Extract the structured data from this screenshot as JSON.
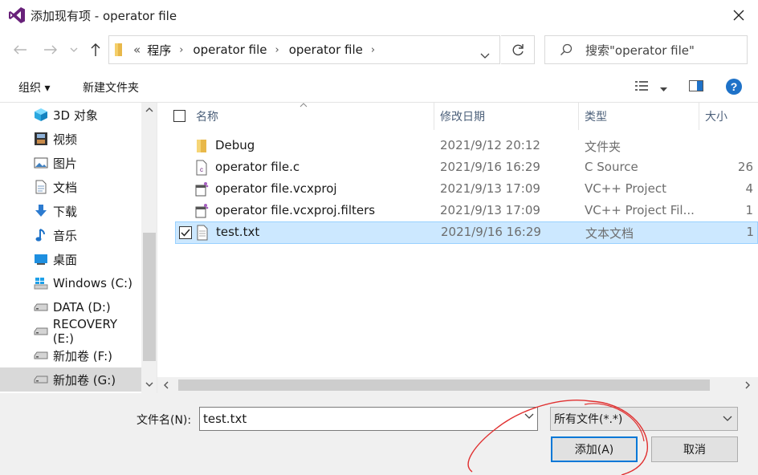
{
  "window": {
    "title": "添加现有项 - operator file",
    "accent_color": "#0078d7",
    "logo_color": "#68217a"
  },
  "address": {
    "overflow": "«",
    "crumbs": [
      "程序",
      "operator file",
      "operator file"
    ],
    "search_placeholder": "搜索\"operator file\""
  },
  "toolbar": {
    "organize_label": "组织 ▾",
    "new_folder_label": "新建文件夹"
  },
  "sidebar": {
    "items": [
      {
        "label": "3D 对象",
        "icon": "cube-icon"
      },
      {
        "label": "视频",
        "icon": "film-icon"
      },
      {
        "label": "图片",
        "icon": "picture-icon"
      },
      {
        "label": "文档",
        "icon": "document-icon"
      },
      {
        "label": "下载",
        "icon": "download-icon"
      },
      {
        "label": "音乐",
        "icon": "music-icon"
      },
      {
        "label": "桌面",
        "icon": "desktop-icon"
      },
      {
        "label": "Windows (C:)",
        "icon": "windows-drive-icon"
      },
      {
        "label": "DATA (D:)",
        "icon": "drive-icon"
      },
      {
        "label": "RECOVERY (E:)",
        "icon": "drive-icon"
      },
      {
        "label": "新加卷 (F:)",
        "icon": "drive-icon"
      },
      {
        "label": "新加卷 (G:)",
        "icon": "drive-icon",
        "selected": true
      }
    ]
  },
  "columns": {
    "name": "名称",
    "date": "修改日期",
    "type": "类型",
    "size": "大小"
  },
  "files": [
    {
      "name": "Debug",
      "date": "2021/9/12 20:12",
      "type": "文件夹",
      "size": "",
      "icon": "folder-icon"
    },
    {
      "name": "operator file.c",
      "date": "2021/9/16 16:29",
      "type": "C Source",
      "size": "26",
      "icon": "c-source-icon"
    },
    {
      "name": "operator file.vcxproj",
      "date": "2021/9/13 17:09",
      "type": "VC++ Project",
      "size": "4",
      "icon": "vcxproj-icon"
    },
    {
      "name": "operator file.vcxproj.filters",
      "date": "2021/9/13 17:09",
      "type": "VC++ Project Fil...",
      "size": "1",
      "icon": "vcxproj-icon"
    },
    {
      "name": "test.txt",
      "date": "2021/9/16 16:29",
      "type": "文本文档",
      "size": "1",
      "icon": "text-file-icon",
      "selected": true
    }
  ],
  "bottom": {
    "filename_label": "文件名(N):",
    "filename_value": "test.txt",
    "filter_value": "所有文件(*.*)",
    "add_label": "添加(A)",
    "cancel_label": "取消"
  }
}
